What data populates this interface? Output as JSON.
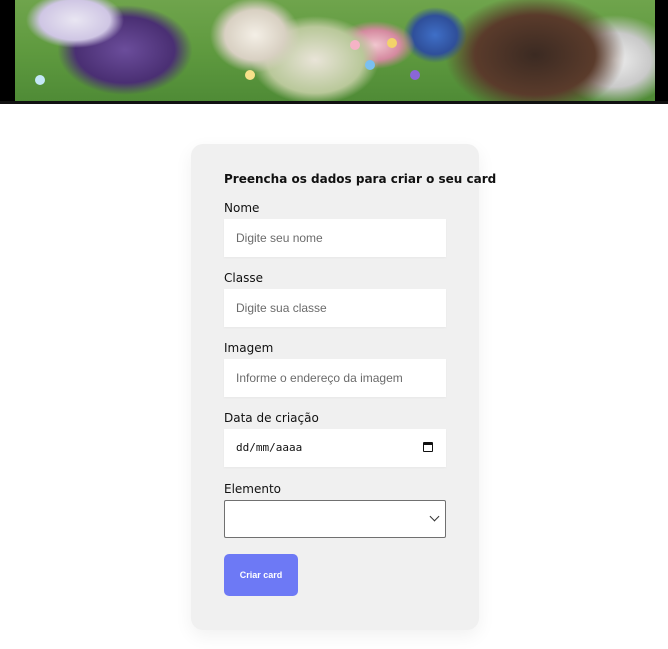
{
  "banner": {
    "alt": "anime characters banner"
  },
  "form": {
    "title": "Preencha os dados para criar o seu card",
    "name": {
      "label": "Nome",
      "placeholder": "Digite seu nome"
    },
    "class": {
      "label": "Classe",
      "placeholder": "Digite sua classe"
    },
    "image": {
      "label": "Imagem",
      "placeholder": "Informe o endereço da imagem"
    },
    "date": {
      "label": "Data de criação",
      "value": "dd/mm/aaaa"
    },
    "element": {
      "label": "Elemento",
      "value": ""
    },
    "submit_label": "Criar card"
  },
  "colors": {
    "button": "#6d79f5",
    "card": "#f0f0f0"
  },
  "icons": {
    "date": "calendar-icon",
    "select": "chevron-down-icon"
  }
}
